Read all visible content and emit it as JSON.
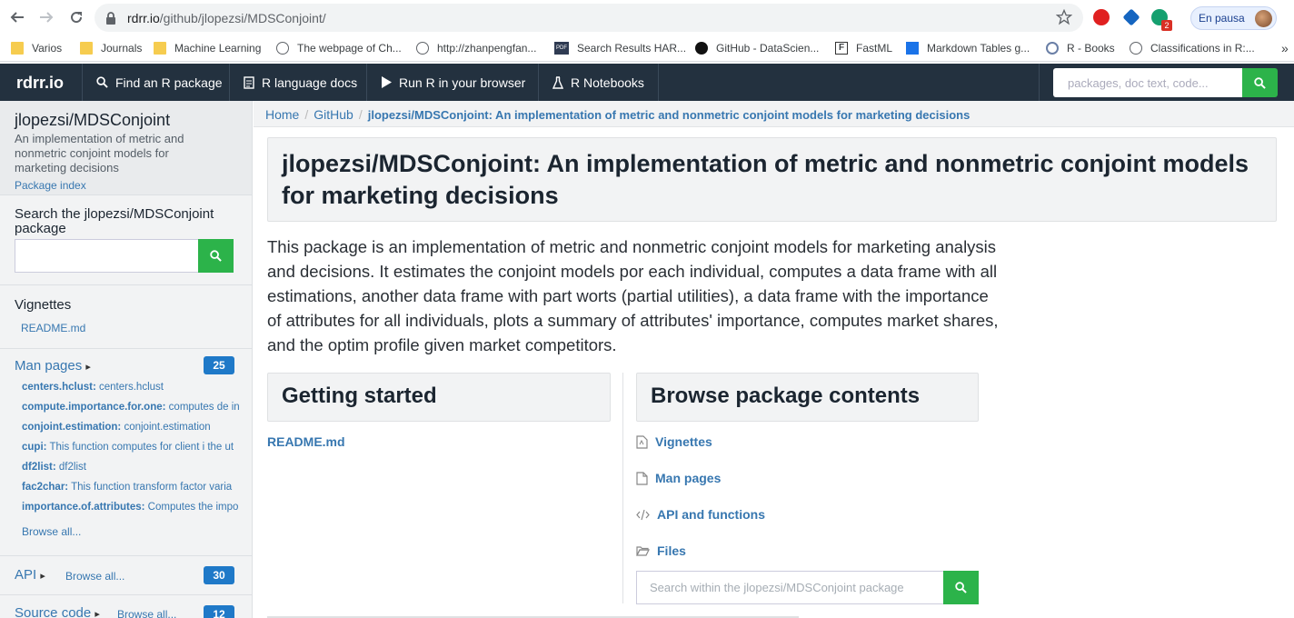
{
  "browser": {
    "url_host": "rdrr.io",
    "url_path": "/github/jlopezsi/MDSConjoint/",
    "profile_label": "En pausa",
    "ext_badge": "2",
    "bookmarks": [
      "Varios",
      "Journals",
      "Machine Learning",
      "The webpage of Ch...",
      "http://zhanpengfan...",
      "Search Results HAR...",
      "GitHub - DataScien...",
      "FastML",
      "Markdown Tables g...",
      "R - Books",
      "Classifications in R:..."
    ],
    "bookmark_icon_text": {
      "pdf": "PDF",
      "fastml": "F"
    },
    "overflow": "»"
  },
  "site": {
    "brand": "rdrr.io",
    "nav": [
      "Find an R package",
      "R language docs",
      "Run R in your browser",
      "R Notebooks"
    ],
    "search_placeholder": "packages, doc text, code..."
  },
  "sidebar": {
    "title": "jlopezsi/MDSConjoint",
    "desc": "An implementation of metric and nonmetric conjoint models for marketing decisions",
    "package_index": "Package index",
    "search_label": "Search the jlopezsi/MDSConjoint package",
    "vignettes_label": "Vignettes",
    "vignette_item": "README.md",
    "man_label": "Man pages",
    "man_count": "25",
    "man_items": [
      {
        "name": "centers.hclust:",
        "desc": "centers.hclust"
      },
      {
        "name": "compute.importance.for.one:",
        "desc": "computes de in"
      },
      {
        "name": "conjoint.estimation:",
        "desc": "conjoint.estimation"
      },
      {
        "name": "cupi:",
        "desc": "This function computes for client i the ut"
      },
      {
        "name": "df2list:",
        "desc": "df2list"
      },
      {
        "name": "fac2char:",
        "desc": "This function transform factor varia"
      },
      {
        "name": "importance.of.attributes:",
        "desc": "Computes the impo"
      }
    ],
    "browse_all": "Browse all...",
    "api_label": "API",
    "api_count": "30",
    "source_label": "Source code",
    "source_count": "12"
  },
  "breadcrumb": {
    "home": "Home",
    "github": "GitHub",
    "current": "jlopezsi/MDSConjoint: An implementation of metric and nonmetric conjoint models for marketing decisions"
  },
  "main": {
    "title": "jlopezsi/MDSConjoint: An implementation of metric and nonmetric conjoint models for marketing decisions",
    "description": "This package is an implementation of metric and nonmetric conjoint models for marketing analysis and decisions. It estimates the conjoint models por each individual, computes a data frame with all estimations, another data frame with part worts (partial utilities), a data frame with the importance of attributes for all individuals, plots a summary of attributes' importance, computes market shares, and the optim profile given market competitors.",
    "getting_started": "Getting started",
    "gs_link": "README.md",
    "browse_title": "Browse package contents",
    "browse_links": [
      "Vignettes",
      "Man pages",
      "API and functions",
      "Files"
    ],
    "content_search_placeholder": "Search within the jlopezsi/MDSConjoint package"
  }
}
